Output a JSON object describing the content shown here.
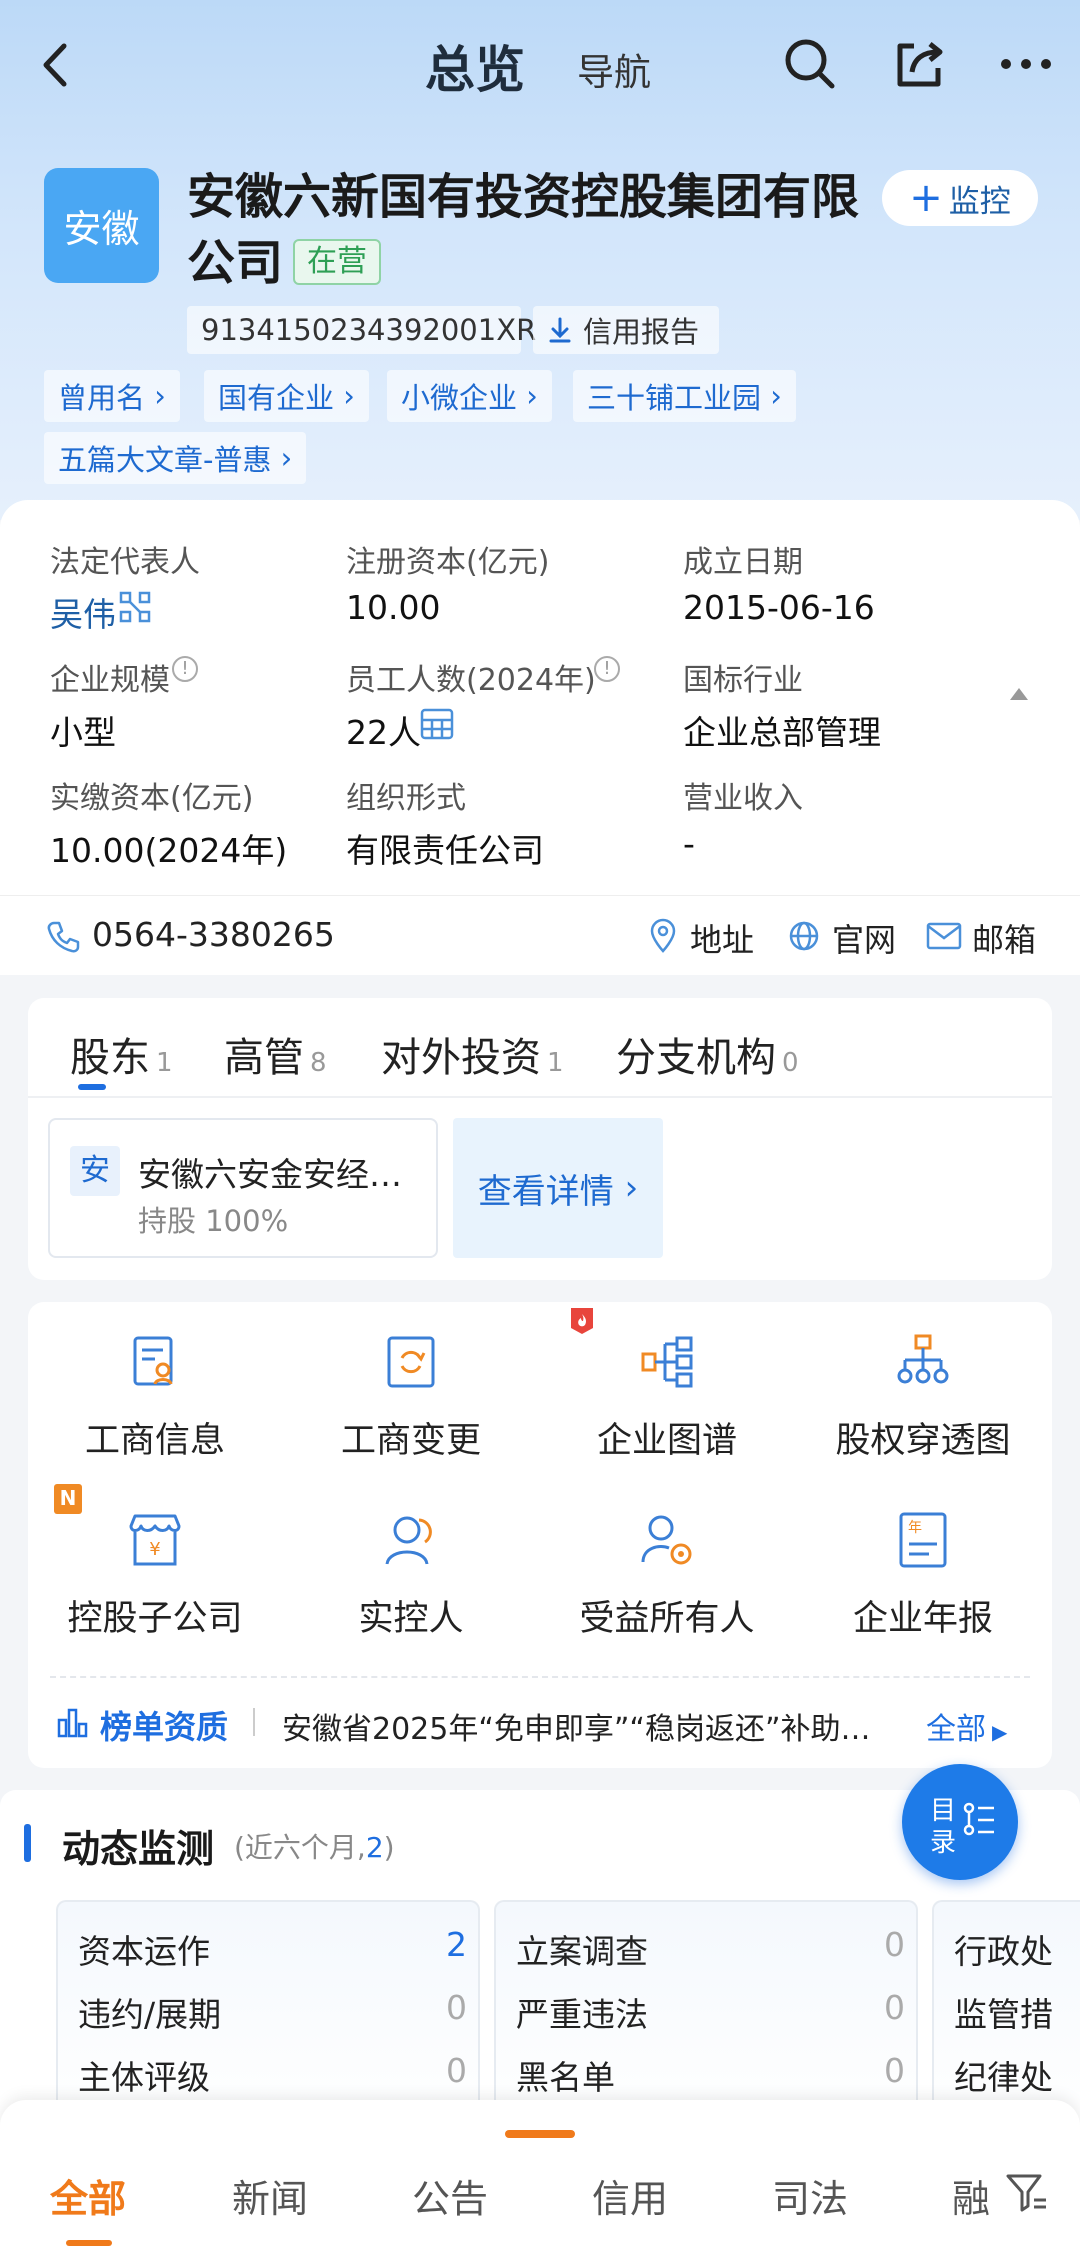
{
  "nav": {
    "title": "总览",
    "guide": "导航"
  },
  "company": {
    "logo_text": "安徽",
    "name": "安徽六新国有投资控股集团有限公司",
    "status": "在营",
    "credit_code": "9134150234392001XR",
    "credit_report": "信用报告",
    "monitor": "监控"
  },
  "tags": [
    "曾用名",
    "国有企业",
    "小微企业",
    "三十铺工业园",
    "五篇大文章-普惠"
  ],
  "info": [
    {
      "label": "法定代表人",
      "value": "吴伟"
    },
    {
      "label": "注册资本(亿元)",
      "value": "10.00"
    },
    {
      "label": "成立日期",
      "value": "2015-06-16"
    },
    {
      "label": "企业规模",
      "value": "小型"
    },
    {
      "label": "员工人数(2024年)",
      "value": "22人"
    },
    {
      "label": "国标行业",
      "value": "企业总部管理"
    },
    {
      "label": "实缴资本(亿元)",
      "value": "10.00(2024年)"
    },
    {
      "label": "组织形式",
      "value": "有限责任公司"
    },
    {
      "label": "营业收入",
      "value": "-"
    }
  ],
  "contact": {
    "phone": "0564-3380265",
    "address": "地址",
    "website": "官网",
    "email": "邮箱"
  },
  "tabs": [
    {
      "label": "股东",
      "count": "1"
    },
    {
      "label": "高管",
      "count": "8"
    },
    {
      "label": "对外投资",
      "count": "1"
    },
    {
      "label": "分支机构",
      "count": "0"
    }
  ],
  "shareholder": {
    "icon_text": "安",
    "name": "安徽六安金安经…",
    "share": "持股 100%",
    "detail": "查看详情"
  },
  "grid": [
    "工商信息",
    "工商变更",
    "企业图谱",
    "股权穿透图",
    "控股子公司",
    "实控人",
    "受益所有人",
    "企业年报"
  ],
  "badges": {
    "new": "N",
    "report": "年"
  },
  "ranking": {
    "title": "榜单资质",
    "text": "安徽省2025年“免申即享”“稳岗返还”补助…",
    "all": "全部"
  },
  "monitor_section": {
    "title": "动态监测",
    "sub_prefix": "(近六个月,",
    "sub_count": "2",
    "sub_suffix": ")",
    "col1": [
      {
        "label": "资本运作",
        "count": "2"
      },
      {
        "label": "违约/展期",
        "count": "0"
      },
      {
        "label": "主体评级",
        "count": "0"
      }
    ],
    "col2": [
      {
        "label": "立案调查",
        "count": "0"
      },
      {
        "label": "严重违法",
        "count": "0"
      },
      {
        "label": "黑名单",
        "count": "0"
      }
    ],
    "col3": [
      {
        "label": "行政处"
      },
      {
        "label": "监管措"
      },
      {
        "label": "纪律处"
      }
    ]
  },
  "toc": {
    "line1": "目",
    "line2": "录"
  },
  "bottom_tabs": [
    "全部",
    "新闻",
    "公告",
    "信用",
    "司法",
    "融"
  ],
  "colors": {
    "accent": "#1e6ee0",
    "orange": "#f07a1a",
    "green": "#2e9f55"
  }
}
